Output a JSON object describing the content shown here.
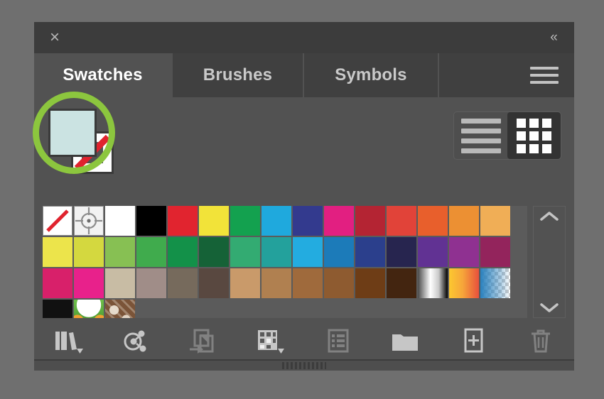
{
  "panel": {
    "close_label": "×",
    "collapse_label": "«",
    "menu_icon": "hamburger-menu-icon"
  },
  "tabs": [
    {
      "label": "Swatches",
      "active": true
    },
    {
      "label": "Brushes",
      "active": false
    },
    {
      "label": "Symbols",
      "active": false
    }
  ],
  "fill_stroke": {
    "fill_color": "#cbe3e2",
    "stroke_color": "#ffffff",
    "stroke_is_none": true,
    "highlight_color": "#8cc63e",
    "fill_name": "fill-swatch",
    "stroke_name": "stroke-swatch"
  },
  "view_toggle": {
    "list_view_label": "list-view",
    "grid_view_label": "grid-view",
    "selected": "grid-view"
  },
  "swatches": {
    "rows": [
      [
        {
          "name": "none",
          "type": "none",
          "color": "#ffffff"
        },
        {
          "name": "registration",
          "type": "registration",
          "color": "#f2f2f2"
        },
        {
          "name": "white",
          "type": "solid",
          "color": "#ffffff"
        },
        {
          "name": "black",
          "type": "solid",
          "color": "#000000"
        },
        {
          "name": "red",
          "type": "solid",
          "color": "#e1242f"
        },
        {
          "name": "yellow",
          "type": "solid",
          "color": "#f2e339"
        },
        {
          "name": "green",
          "type": "solid",
          "color": "#13a14f"
        },
        {
          "name": "blue",
          "type": "solid",
          "color": "#1fa9dd"
        },
        {
          "name": "dark-blue",
          "type": "solid",
          "color": "#333a8e"
        },
        {
          "name": "magenta",
          "type": "solid",
          "color": "#e21f81"
        },
        {
          "name": "crimson",
          "type": "solid",
          "color": "#b42433"
        },
        {
          "name": "red-orange",
          "type": "solid",
          "color": "#e14339"
        },
        {
          "name": "orange",
          "type": "solid",
          "color": "#e85f2c"
        },
        {
          "name": "amber",
          "type": "solid",
          "color": "#ec9033"
        },
        {
          "name": "light-orange",
          "type": "solid",
          "color": "#f0ae56"
        }
      ],
      [
        {
          "name": "lemon",
          "type": "solid",
          "color": "#ece44b"
        },
        {
          "name": "citron",
          "type": "solid",
          "color": "#d4d83f"
        },
        {
          "name": "lime-green",
          "type": "solid",
          "color": "#87c053"
        },
        {
          "name": "leaf-green",
          "type": "solid",
          "color": "#40ab4d"
        },
        {
          "name": "emerald",
          "type": "solid",
          "color": "#139149"
        },
        {
          "name": "forest-green",
          "type": "solid",
          "color": "#156237"
        },
        {
          "name": "jade",
          "type": "solid",
          "color": "#33ab72"
        },
        {
          "name": "teal",
          "type": "solid",
          "color": "#23a19c"
        },
        {
          "name": "sky-blue",
          "type": "solid",
          "color": "#23ace0"
        },
        {
          "name": "ocean-blue",
          "type": "solid",
          "color": "#1c7bb9"
        },
        {
          "name": "royal-blue",
          "type": "solid",
          "color": "#2b3f8c"
        },
        {
          "name": "navy",
          "type": "solid",
          "color": "#27254f"
        },
        {
          "name": "violet",
          "type": "solid",
          "color": "#613293"
        },
        {
          "name": "purple",
          "type": "solid",
          "color": "#8f3191"
        },
        {
          "name": "plum",
          "type": "solid",
          "color": "#93245c"
        }
      ],
      [
        {
          "name": "rose",
          "type": "solid",
          "color": "#d8206a"
        },
        {
          "name": "pink",
          "type": "solid",
          "color": "#e8218b"
        },
        {
          "name": "sand",
          "type": "solid",
          "color": "#c8bca4"
        },
        {
          "name": "taupe",
          "type": "solid",
          "color": "#a08d88"
        },
        {
          "name": "warm-gray",
          "type": "solid",
          "color": "#766a5c"
        },
        {
          "name": "dark-taupe",
          "type": "solid",
          "color": "#594840"
        },
        {
          "name": "tan",
          "type": "solid",
          "color": "#c99a6a"
        },
        {
          "name": "camel",
          "type": "solid",
          "color": "#b08050"
        },
        {
          "name": "bronze",
          "type": "solid",
          "color": "#9f6a3c"
        },
        {
          "name": "sienna",
          "type": "solid",
          "color": "#8e5b30"
        },
        {
          "name": "chocolate",
          "type": "solid",
          "color": "#6e3d16"
        },
        {
          "name": "dark-brown",
          "type": "solid",
          "color": "#432510"
        },
        {
          "name": "white-black-gradient",
          "type": "gradient",
          "color": "linear-gradient(90deg,#4a4a4a 0%,#ffffff 42%,#c9c9c9 70%,#000000 100%)"
        },
        {
          "name": "yellow-red-gradient",
          "type": "gradient",
          "color": "linear-gradient(90deg,#fcc830 0%,#f6a63a 45%,#e8503c 100%)"
        },
        {
          "name": "blue-fade-gradient",
          "type": "gradient-checker",
          "color": "linear-gradient(90deg,rgba(42,129,190,1) 0%,rgba(42,129,190,0.35) 70%,rgba(42,129,190,0) 100%)"
        }
      ],
      [
        {
          "name": "pattern-soft-dot",
          "type": "pattern",
          "color": "#111111"
        },
        {
          "name": "pattern-foliage",
          "type": "pattern",
          "color": "#5fa83c"
        },
        {
          "name": "pattern-ornament",
          "type": "pattern",
          "color": "#7b5438"
        }
      ]
    ]
  },
  "scrollbar": {
    "up_arrow": "chevron-up-icon",
    "down_arrow": "chevron-down-icon"
  },
  "toolbar": [
    {
      "name": "swatch-libraries-menu",
      "icon": "books-icon",
      "dimmed": false,
      "has_caret": true
    },
    {
      "name": "show-swatch-kinds-menu",
      "icon": "color-group-icon",
      "dimmed": false,
      "has_caret": false
    },
    {
      "name": "add-selected-to-swatches",
      "icon": "import-swatch-icon",
      "dimmed": true,
      "has_caret": false
    },
    {
      "name": "swatch-libraries-options",
      "icon": "swatch-kinds-icon",
      "dimmed": false,
      "has_caret": true
    },
    {
      "name": "swatch-options",
      "icon": "options-list-icon",
      "dimmed": true,
      "has_caret": false
    },
    {
      "name": "new-color-group",
      "icon": "folder-icon",
      "dimmed": false,
      "has_caret": false
    },
    {
      "name": "new-swatch",
      "icon": "new-swatch-icon",
      "dimmed": false,
      "has_caret": false
    },
    {
      "name": "delete-swatch",
      "icon": "trash-icon",
      "dimmed": true,
      "has_caret": false
    }
  ],
  "footer": {
    "grip": "resize-grip"
  }
}
